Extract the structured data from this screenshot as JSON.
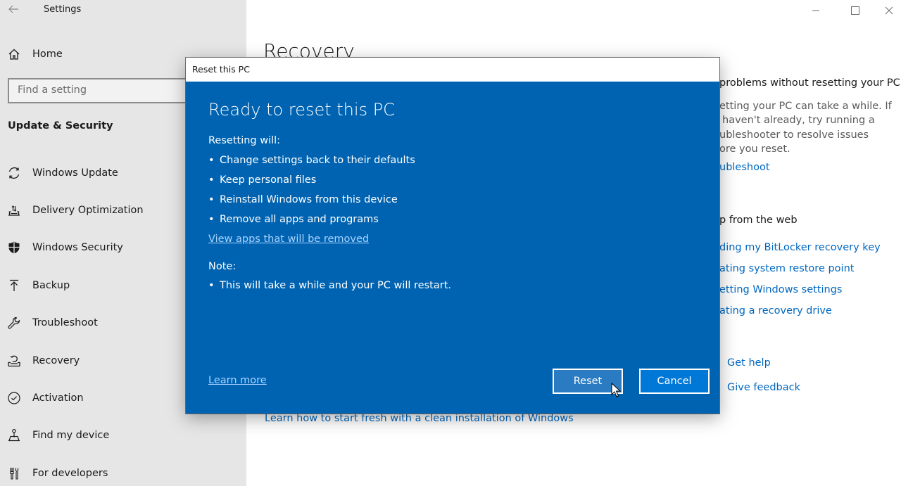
{
  "window": {
    "app_title": "Settings",
    "controls": {
      "minimize": "minimize-icon",
      "maximize": "maximize-icon",
      "close": "close-icon"
    }
  },
  "sidebar": {
    "back_icon": "back-arrow-icon",
    "home": {
      "label": "Home",
      "icon": "home-icon"
    },
    "search": {
      "placeholder": "Find a setting",
      "value": ""
    },
    "section_heading": "Update & Security",
    "items": [
      {
        "label": "Windows Update",
        "icon": "sync-icon"
      },
      {
        "label": "Delivery Optimization",
        "icon": "delivery-optimization-icon"
      },
      {
        "label": "Windows Security",
        "icon": "shield-icon"
      },
      {
        "label": "Backup",
        "icon": "backup-arrow-icon"
      },
      {
        "label": "Troubleshoot",
        "icon": "wrench-icon"
      },
      {
        "label": "Recovery",
        "icon": "recovery-icon"
      },
      {
        "label": "Activation",
        "icon": "check-circle-icon"
      },
      {
        "label": "Find my device",
        "icon": "find-device-icon"
      },
      {
        "label": "For developers",
        "icon": "developer-tools-icon"
      }
    ]
  },
  "main": {
    "page_title": "Recovery",
    "fix_section": {
      "heading": "problems without resetting your PC",
      "text_lines": [
        "etting your PC can take a while. If",
        "haven't already, try running a",
        "ubleshooter to resolve issues",
        "ore you reset."
      ],
      "link": "ubleshoot"
    },
    "web_help": {
      "heading": "p from the web",
      "links": [
        "ding my BitLocker recovery key",
        "ating system restore point",
        "etting Windows settings",
        "ating a recovery drive"
      ]
    },
    "support_links": {
      "get_help": "Get help",
      "give_feedback": "Give feedback"
    },
    "clean_install_link": "Learn how to start fresh with a clean installation of Windows"
  },
  "dialog": {
    "title": "Reset this PC",
    "heading": "Ready to reset this PC",
    "resetting_label": "Resetting will:",
    "resetting_items": [
      "Change settings back to their defaults",
      "Keep personal files",
      "Reinstall Windows from this device",
      "Remove all apps and programs"
    ],
    "view_apps_link": "View apps that will be removed",
    "note_label": "Note:",
    "note_items": [
      "This will take a while and your PC will restart."
    ],
    "learn_more_link": "Learn more",
    "reset_button": "Reset",
    "cancel_button": "Cancel",
    "colors": {
      "body": "#0063b1",
      "link": "#a8d4ff"
    }
  }
}
